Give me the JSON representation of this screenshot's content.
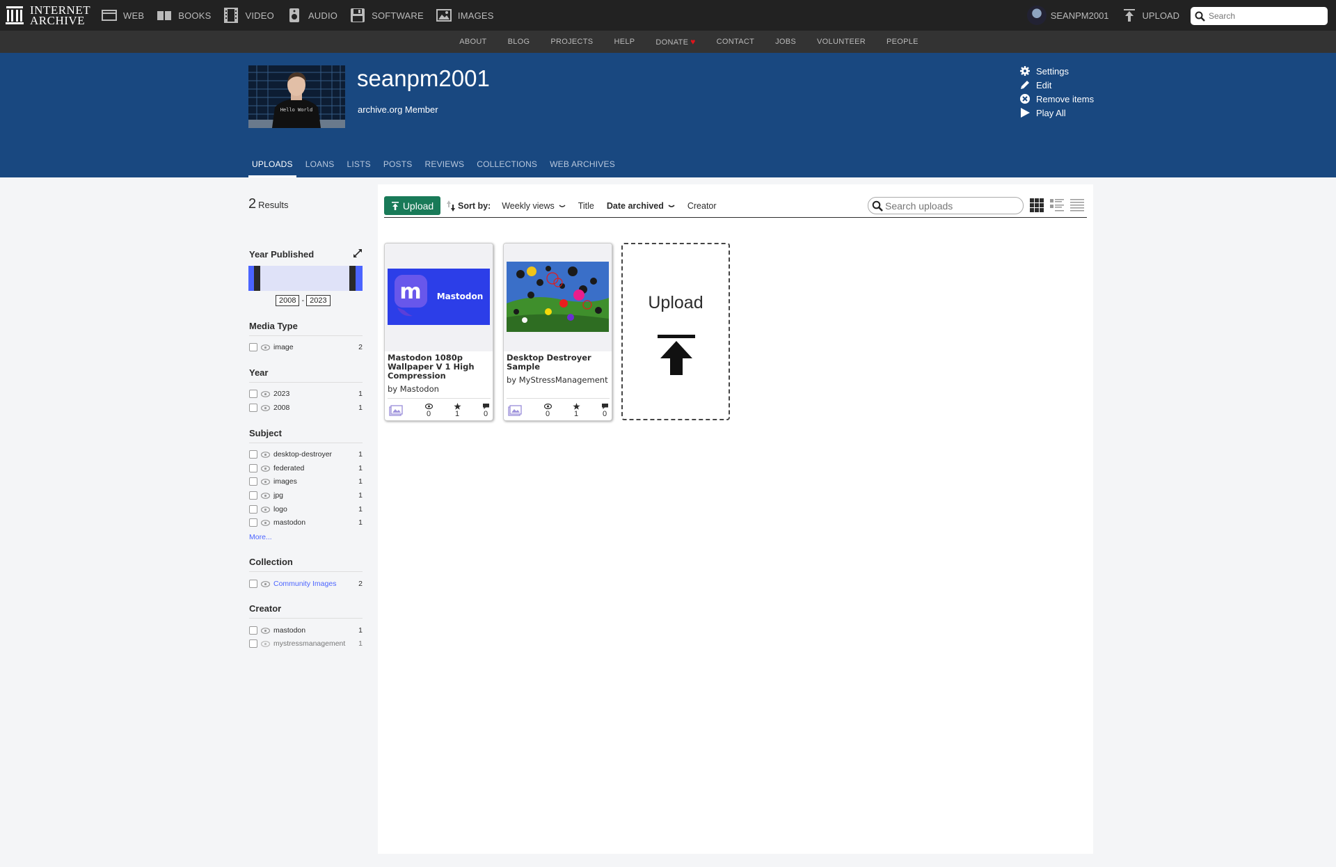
{
  "topbar": {
    "logo_line1": "INTERNET",
    "logo_line2": "ARCHIVE",
    "media": [
      {
        "label": "WEB",
        "icon": "web-icon"
      },
      {
        "label": "BOOKS",
        "icon": "books-icon"
      },
      {
        "label": "VIDEO",
        "icon": "video-icon"
      },
      {
        "label": "AUDIO",
        "icon": "audio-icon"
      },
      {
        "label": "SOFTWARE",
        "icon": "software-icon"
      },
      {
        "label": "IMAGES",
        "icon": "images-icon"
      }
    ],
    "username": "SEANPM2001",
    "upload_label": "UPLOAD",
    "search_placeholder": "Search"
  },
  "subnav": {
    "items": [
      "ABOUT",
      "BLOG",
      "PROJECTS",
      "HELP",
      "DONATE",
      "CONTACT",
      "JOBS",
      "VOLUNTEER",
      "PEOPLE"
    ]
  },
  "profile": {
    "name": "seanpm2001",
    "role": "archive.org Member",
    "photo_shirt_text": "Hello World",
    "actions": [
      "Settings",
      "Edit",
      "Remove items",
      "Play All"
    ],
    "tabs": [
      "UPLOADS",
      "LOANS",
      "LISTS",
      "POSTS",
      "REVIEWS",
      "COLLECTIONS",
      "WEB ARCHIVES"
    ],
    "active_tab": "UPLOADS"
  },
  "results": {
    "count": "2",
    "label": "Results"
  },
  "facets": {
    "year_published": {
      "title": "Year Published",
      "from": "2008",
      "to": "2023",
      "sep": "-"
    },
    "media_type": {
      "title": "Media Type",
      "items": [
        {
          "label": "image",
          "count": "2"
        }
      ]
    },
    "year": {
      "title": "Year",
      "items": [
        {
          "label": "2023",
          "count": "1"
        },
        {
          "label": "2008",
          "count": "1"
        }
      ]
    },
    "subject": {
      "title": "Subject",
      "items": [
        {
          "label": "desktop-destroyer",
          "count": "1"
        },
        {
          "label": "federated",
          "count": "1"
        },
        {
          "label": "images",
          "count": "1"
        },
        {
          "label": "jpg",
          "count": "1"
        },
        {
          "label": "logo",
          "count": "1"
        },
        {
          "label": "mastodon",
          "count": "1"
        }
      ],
      "more": "More..."
    },
    "collection": {
      "title": "Collection",
      "items": [
        {
          "label": "Community Images",
          "count": "2"
        }
      ]
    },
    "creator": {
      "title": "Creator",
      "items": [
        {
          "label": "mastodon",
          "count": "1"
        },
        {
          "label": "mystressmanagement",
          "count": "1"
        }
      ]
    }
  },
  "toolbar": {
    "upload_button": "Upload",
    "sort_by_label": "Sort by:",
    "sort_options": [
      "Weekly views",
      "Title",
      "Date archived",
      "Creator"
    ],
    "active_sort": "Date archived",
    "search_placeholder": "Search uploads"
  },
  "tiles": [
    {
      "title": "Mastodon 1080p Wallpaper V 1 High Compression",
      "by": "by Mastodon",
      "thumb_text": "Mastodon",
      "views": "0",
      "favorites": "1",
      "reviews": "0",
      "media_icon": "image-icon"
    },
    {
      "title": "Desktop Destroyer Sample",
      "by": "by MyStressManagement",
      "views": "0",
      "favorites": "1",
      "reviews": "0",
      "media_icon": "image-icon"
    }
  ],
  "upload_tile": {
    "label": "Upload"
  },
  "colors": {
    "topbar": "#222222",
    "subnav": "#333333",
    "profile_bg": "#194880",
    "upload_button": "#197a58",
    "link": "#4b64ff",
    "mastodon_purple": "#6364ff"
  }
}
